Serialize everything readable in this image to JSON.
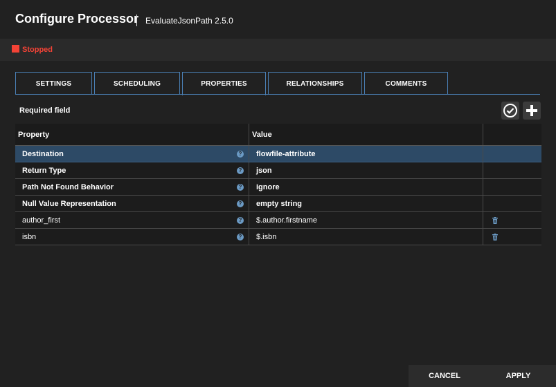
{
  "dialog": {
    "title": "Configure Processor",
    "subtitle": "EvaluateJsonPath 2.5.0"
  },
  "status": {
    "text": "Stopped",
    "color": "#f44336"
  },
  "tabs": [
    {
      "label": "SETTINGS"
    },
    {
      "label": "SCHEDULING"
    },
    {
      "label": "PROPERTIES",
      "active": true
    },
    {
      "label": "RELATIONSHIPS"
    },
    {
      "label": "COMMENTS"
    }
  ],
  "properties": {
    "required_label": "Required field",
    "verify_icon": "check-circle-icon",
    "add_icon": "plus-icon",
    "columns": {
      "property": "Property",
      "value": "Value"
    },
    "rows": [
      {
        "name": "Destination",
        "value": "flowfile-attribute",
        "required": true,
        "deletable": false
      },
      {
        "name": "Return Type",
        "value": "json",
        "required": true,
        "deletable": false
      },
      {
        "name": "Path Not Found Behavior",
        "value": "ignore",
        "required": true,
        "deletable": false
      },
      {
        "name": "Null Value Representation",
        "value": "empty string",
        "required": true,
        "deletable": false
      },
      {
        "name": "author_first",
        "value": "$.author.firstname",
        "required": false,
        "deletable": true
      },
      {
        "name": "isbn",
        "value": "$.isbn",
        "required": false,
        "deletable": true
      }
    ],
    "help_glyph": "?"
  },
  "footer": {
    "cancel": "CANCEL",
    "apply": "APPLY"
  }
}
